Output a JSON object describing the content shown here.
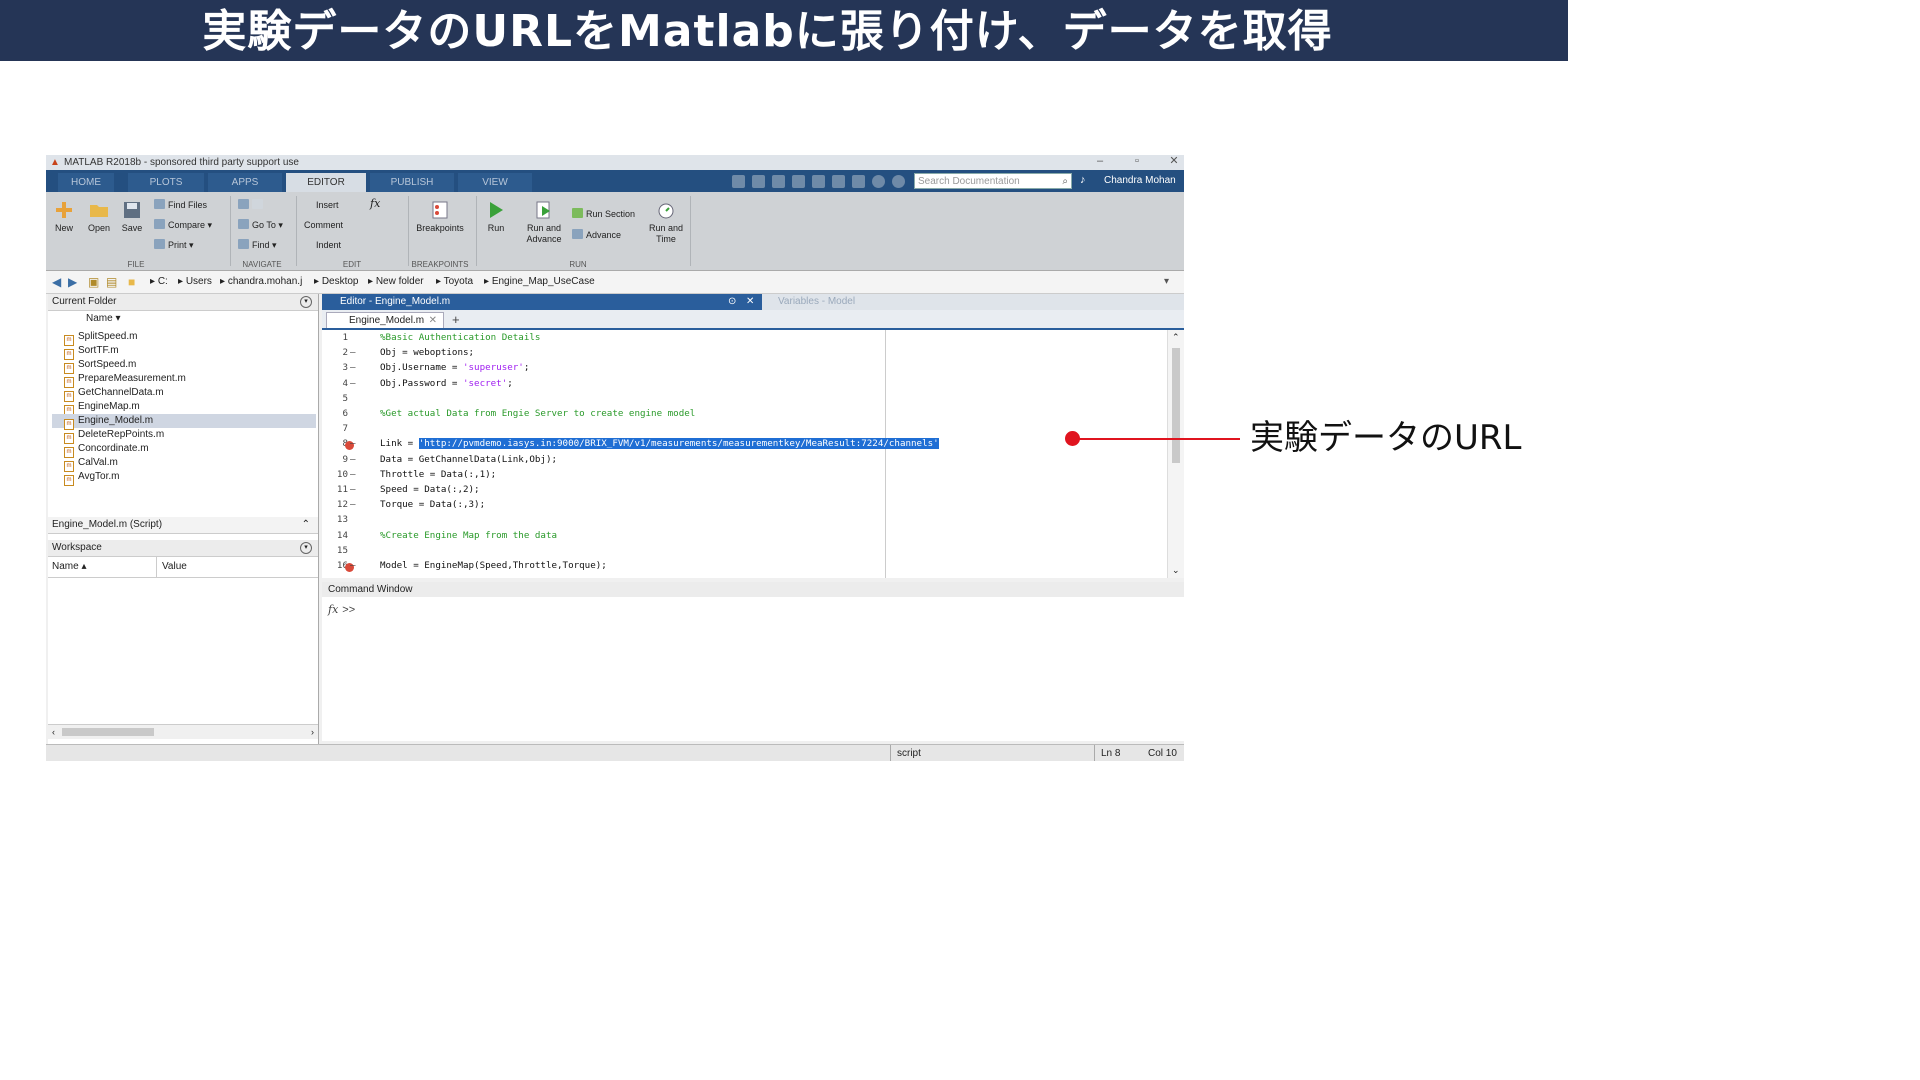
{
  "banner": {
    "title": "実験データのURLをMatlabに張り付け、データを取得"
  },
  "callout": {
    "label": "実験データのURL"
  },
  "window": {
    "title": "MATLAB R2018b - sponsored third party support use",
    "minimize": "–",
    "restore": "▫",
    "close": "✕"
  },
  "tabs": [
    "HOME",
    "PLOTS",
    "APPS",
    "EDITOR",
    "PUBLISH",
    "VIEW"
  ],
  "active_tab": "EDITOR",
  "search": {
    "placeholder": "Search Documentation"
  },
  "user": "Chandra Mohan",
  "ribbon": {
    "file": {
      "new": "New",
      "open": "Open",
      "save": "Save",
      "find_files": "Find Files",
      "compare": "Compare",
      "print": "Print",
      "group": "FILE"
    },
    "navigate": {
      "go_to": "Go To",
      "find": "Find",
      "group": "NAVIGATE"
    },
    "edit": {
      "insert": "Insert",
      "comment": "Comment",
      "indent": "Indent",
      "fx": "fx",
      "group": "EDIT"
    },
    "breakpoints": {
      "label": "Breakpoints",
      "group": "BREAKPOINTS"
    },
    "run": {
      "run": "Run",
      "run_and_advance_1": "Run and",
      "run_and_advance_2": "Advance",
      "run_section": "Run Section",
      "advance": "Advance",
      "run_and_time_1": "Run and",
      "run_and_time_2": "Time",
      "group": "RUN"
    }
  },
  "path": [
    "C:",
    "Users",
    "chandra.mohan.j",
    "Desktop",
    "New folder",
    "Toyota",
    "Engine_Map_UseCase"
  ],
  "current_folder": {
    "title": "Current Folder",
    "column": "Name ▾",
    "files": [
      "SplitSpeed.m",
      "SortTF.m",
      "SortSpeed.m",
      "PrepareMeasurement.m",
      "GetChannelData.m",
      "EngineMap.m",
      "Engine_Model.m",
      "DeleteRepPoints.m",
      "Concordinate.m",
      "CalVal.m",
      "AvgTor.m"
    ],
    "selected": "Engine_Model.m",
    "details": "Engine_Model.m  (Script)"
  },
  "workspace": {
    "title": "Workspace",
    "col_name": "Name ▴",
    "col_value": "Value"
  },
  "editor": {
    "title": "Editor - Engine_Model.m",
    "variables_tab": "Variables - Model",
    "file_tab": "Engine_Model.m",
    "lines": [
      {
        "n": "1",
        "dash": "",
        "bp": false,
        "parts": [
          {
            "t": "%Basic Authentication Details",
            "c": "cmt"
          }
        ]
      },
      {
        "n": "2",
        "dash": "–",
        "bp": false,
        "parts": [
          {
            "t": "Obj = weboptions;",
            "c": ""
          }
        ]
      },
      {
        "n": "3",
        "dash": "–",
        "bp": false,
        "parts": [
          {
            "t": "Obj.Username = ",
            "c": ""
          },
          {
            "t": "'superuser'",
            "c": "str"
          },
          {
            "t": ";",
            "c": ""
          }
        ]
      },
      {
        "n": "4",
        "dash": "–",
        "bp": false,
        "parts": [
          {
            "t": "Obj.Password = ",
            "c": ""
          },
          {
            "t": "'secret'",
            "c": "str"
          },
          {
            "t": ";",
            "c": ""
          }
        ]
      },
      {
        "n": "5",
        "dash": "",
        "bp": false,
        "parts": []
      },
      {
        "n": "6",
        "dash": "",
        "bp": false,
        "parts": [
          {
            "t": "%Get actual Data from Engie Server to create engine model",
            "c": "cmt"
          }
        ]
      },
      {
        "n": "7",
        "dash": "",
        "bp": false,
        "parts": []
      },
      {
        "n": "8",
        "dash": "–",
        "bp": true,
        "parts": [
          {
            "t": "Link = ",
            "c": ""
          },
          {
            "t": "'http://pvmdemo.iasys.in:9000/BRIX_FVM/v1/measurements/measurementkey/MeaResult:7224/channels'",
            "c": "hl"
          }
        ]
      },
      {
        "n": "9",
        "dash": "–",
        "bp": false,
        "parts": [
          {
            "t": "Data = GetChannelData(Link,Obj);",
            "c": ""
          }
        ]
      },
      {
        "n": "10",
        "dash": "–",
        "bp": false,
        "parts": [
          {
            "t": "Throttle = Data(:,1);",
            "c": ""
          }
        ]
      },
      {
        "n": "11",
        "dash": "–",
        "bp": false,
        "parts": [
          {
            "t": "Speed = Data(:,2);",
            "c": ""
          }
        ]
      },
      {
        "n": "12",
        "dash": "–",
        "bp": false,
        "parts": [
          {
            "t": "Torque = Data(:,3);",
            "c": ""
          }
        ]
      },
      {
        "n": "13",
        "dash": "",
        "bp": false,
        "parts": []
      },
      {
        "n": "14",
        "dash": "",
        "bp": false,
        "parts": [
          {
            "t": "%Create Engine Map from the data",
            "c": "cmt"
          }
        ]
      },
      {
        "n": "15",
        "dash": "",
        "bp": false,
        "parts": []
      },
      {
        "n": "16",
        "dash": "–",
        "bp": true,
        "parts": [
          {
            "t": "Model = EngineMap(Speed,Throttle,Torque);",
            "c": ""
          }
        ]
      }
    ]
  },
  "command_window": {
    "title": "Command Window",
    "fx": "fx",
    "prompt": ">>"
  },
  "status": {
    "mode": "script",
    "ln": "Ln  8",
    "col": "Col  10"
  }
}
